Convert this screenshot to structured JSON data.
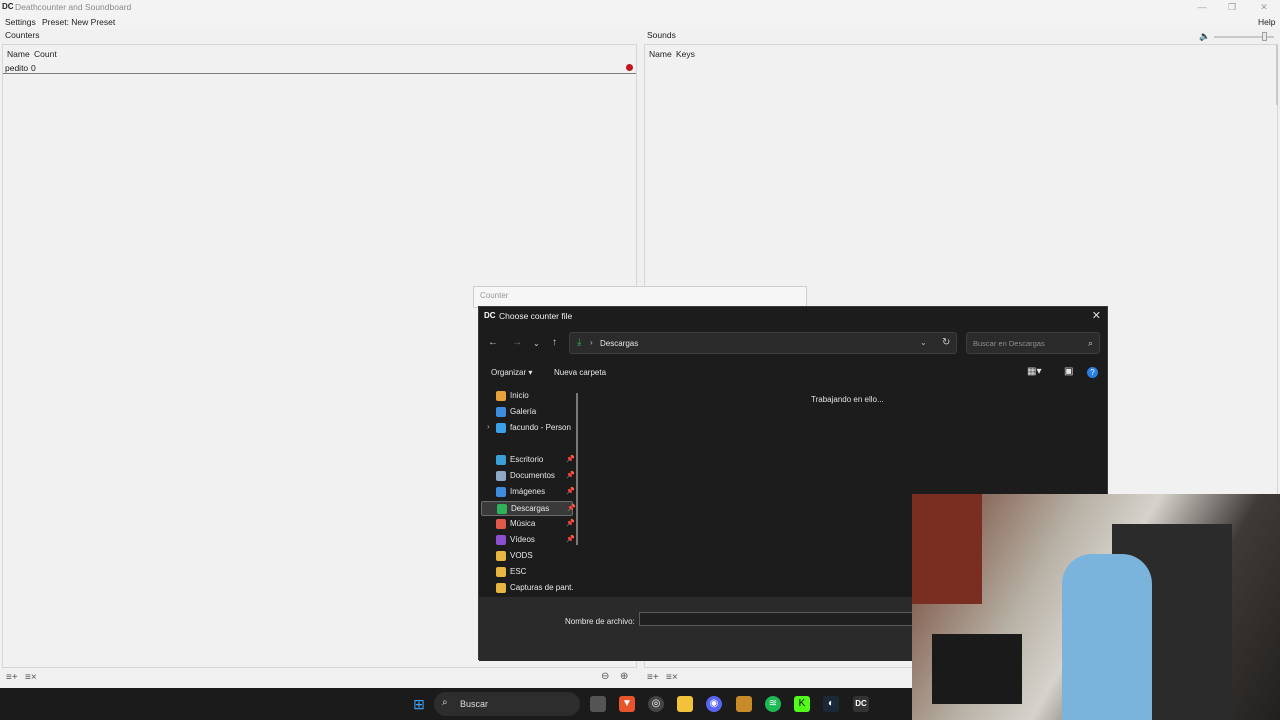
{
  "window": {
    "app_icon": "DC",
    "title": "Deathcounter and Soundboard",
    "controls": [
      "—",
      "❐",
      "✕"
    ]
  },
  "menu": {
    "settings": "Settings",
    "preset": "Preset: New Preset",
    "help": "Help"
  },
  "counters": {
    "heading": "Counters",
    "columns": [
      "Name",
      "Count"
    ],
    "rows": [
      {
        "name": "pedito",
        "count": "0"
      }
    ]
  },
  "sounds": {
    "heading": "Sounds",
    "columns": [
      "Name",
      "Keys"
    ],
    "volume_icon": "speaker-icon",
    "volume": 0.85
  },
  "counter_dialog": {
    "title": "Counter"
  },
  "file_dialog": {
    "icon": "DC",
    "title": "Choose counter file",
    "close": "✕",
    "address": "Descargas",
    "search_placeholder": "Buscar en Descargas",
    "toolbar": {
      "organize": "Organizar ▾",
      "new_folder": "Nueva carpeta"
    },
    "working_text": "Trabajando en ello...",
    "sidebar": [
      {
        "label": "Inicio",
        "color": "#e9a23b",
        "pinned": false
      },
      {
        "label": "Galería",
        "color": "#3c8dde",
        "pinned": false
      },
      {
        "label": "facundo - Person",
        "color": "#3aa0e8",
        "pinned": false
      },
      {
        "label": "Escritorio",
        "color": "#3ca0d8",
        "pinned": true
      },
      {
        "label": "Documentos",
        "color": "#8fa8c8",
        "pinned": true
      },
      {
        "label": "Imágenes",
        "color": "#3c8dde",
        "pinned": true
      },
      {
        "label": "Descargas",
        "color": "#2fb35a",
        "pinned": true
      },
      {
        "label": "Música",
        "color": "#e05a4c",
        "pinned": true
      },
      {
        "label": "Vídeos",
        "color": "#8b4fd0",
        "pinned": true
      },
      {
        "label": "VODS",
        "color": "#e8b540",
        "pinned": false
      },
      {
        "label": "ESC",
        "color": "#e8b540",
        "pinned": false
      },
      {
        "label": "Capturas de pant.",
        "color": "#e8b540",
        "pinned": false
      }
    ],
    "filename_label": "Nombre de archivo:",
    "filename_value": ""
  },
  "taskbar": {
    "search_placeholder": "Buscar",
    "icons": [
      "windows-start-icon",
      "task-view-icon",
      "brave-icon",
      "app-icon",
      "file-explorer-icon",
      "discord-icon",
      "files-icon",
      "spotify-icon",
      "kick-icon",
      "steam-icon",
      "deathcounter-icon"
    ]
  }
}
